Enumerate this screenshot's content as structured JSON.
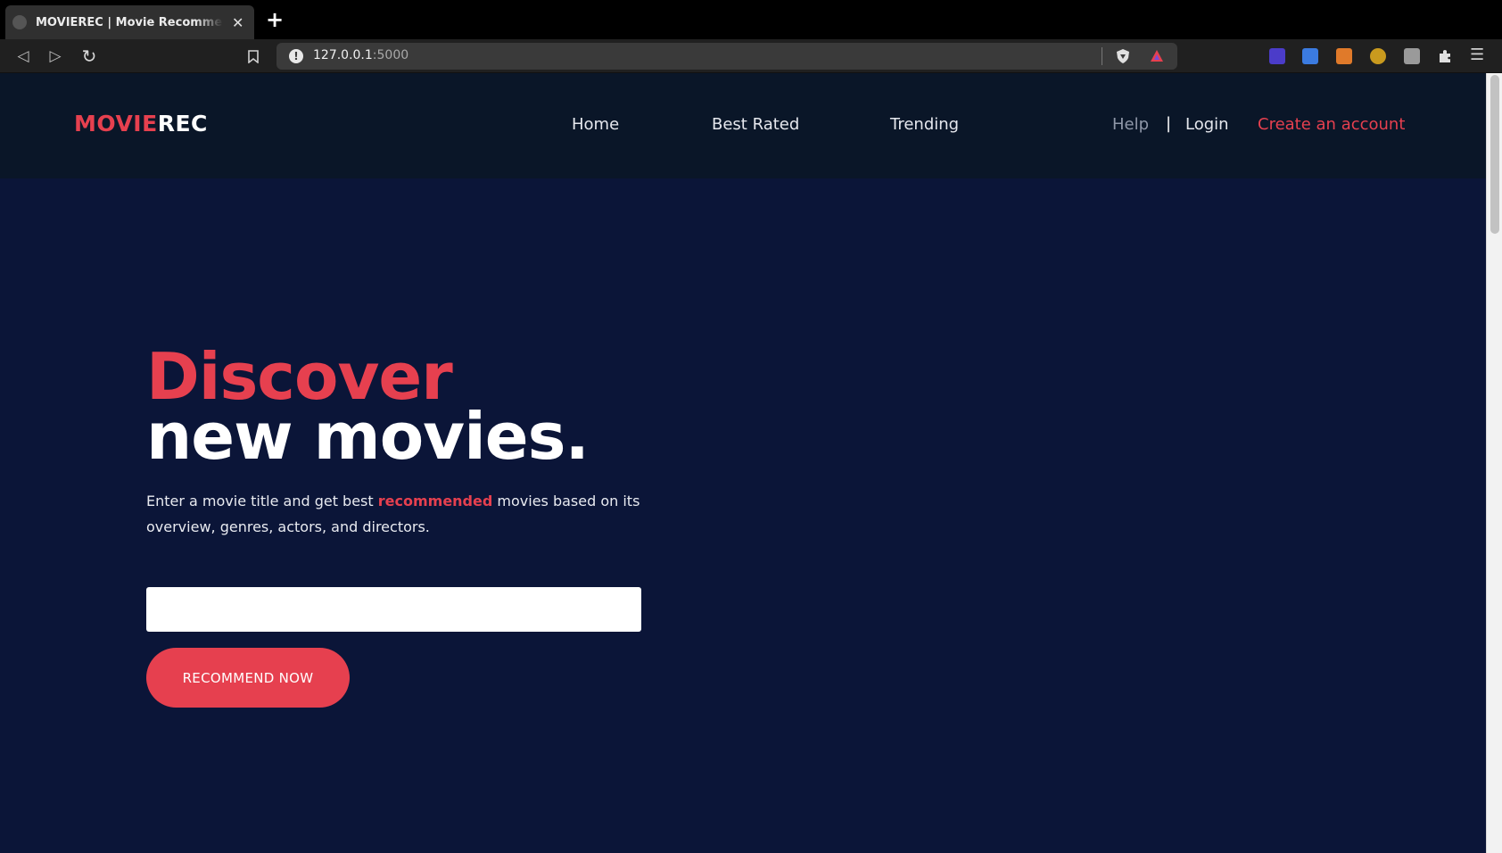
{
  "browser": {
    "tab_title": "MOVIEREC | Movie Recommendation",
    "new_tab_label": "+",
    "tab_close_label": "✕",
    "url_host": "127.0.0.1",
    "url_port": ":5000",
    "info_label": "!",
    "menu_label": "☰",
    "back_icon": "◁",
    "forward_icon": "▷",
    "reload_icon": "↻",
    "bookmark_icon": "bookmark-icon",
    "extensions": [
      "translate-icon",
      "metamask-icon",
      "crypto-icon",
      "screenshot-icon",
      "puzzle-icon"
    ]
  },
  "navbar": {
    "logo_part1": "MOVIE",
    "logo_part2": "REC",
    "links": [
      "Home",
      "Best Rated",
      "Trending"
    ],
    "help": "Help",
    "separator": "|",
    "login": "Login",
    "create_account": "Create an account"
  },
  "hero": {
    "title_line1": "Discover",
    "title_line2": "new movies.",
    "text_before": "Enter a movie title and get best ",
    "text_highlight": "recommended",
    "text_after": " movies based on its overview, genres, actors, and directors.",
    "search_value": "",
    "button_label": "RECOMMEND NOW"
  },
  "colors": {
    "accent": "#e6404f",
    "page_bg": "#0b1538",
    "nav_bg": "#0a1628"
  }
}
